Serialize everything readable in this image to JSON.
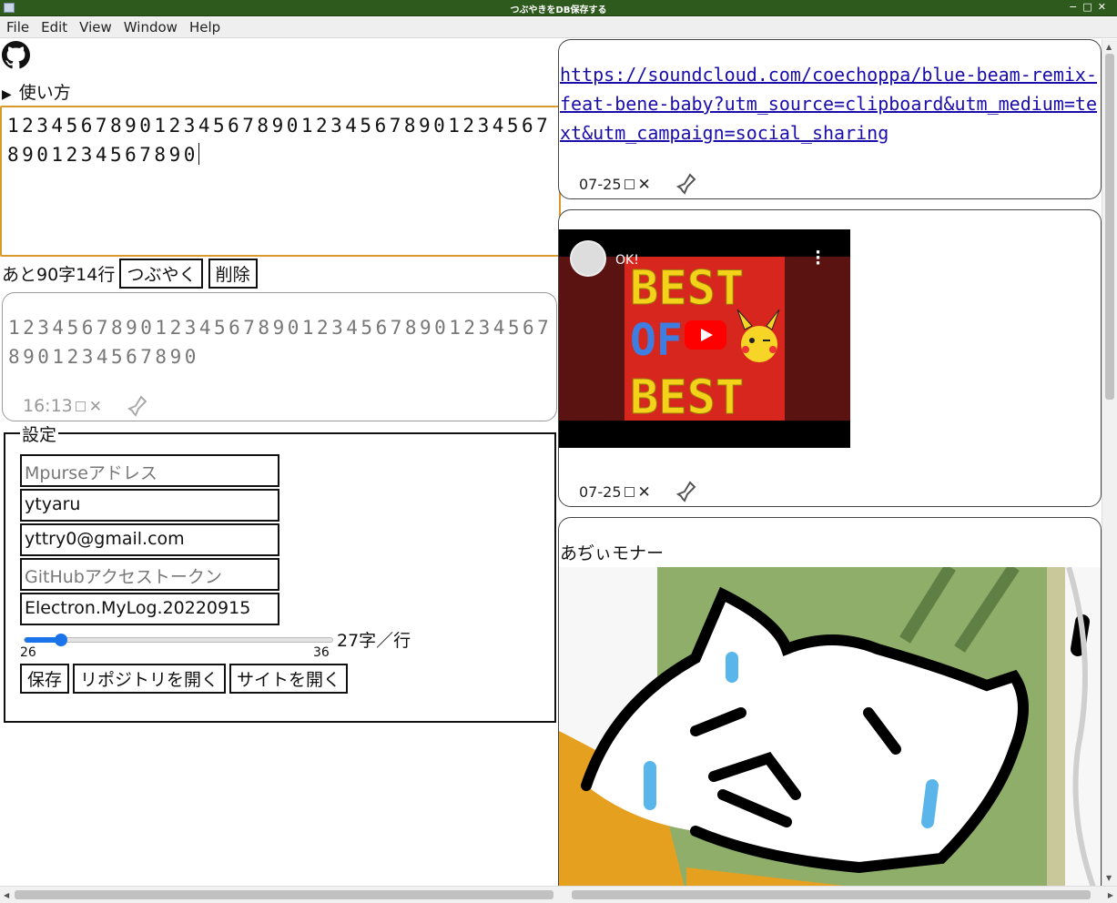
{
  "window": {
    "title": "つぶやきをDB保存する"
  },
  "menu": [
    "File",
    "Edit",
    "View",
    "Window",
    "Help"
  ],
  "left": {
    "usage_label": "使い方",
    "editor_text": "12345678901234567890123456789012345678901234567890",
    "counter": "あと90字14行",
    "tweet_button": "つぶやく",
    "delete_button": "削除",
    "draft": {
      "text": "12345678901234567890123456789012345678901234567890",
      "time": "16:13"
    }
  },
  "settings": {
    "legend": "設定",
    "mpurse_placeholder": "Mpurseアドレス",
    "username": "ytyaru",
    "email": "yttry0@gmail.com",
    "token_placeholder": "GitHubアクセストークン",
    "repo": "Electron.MyLog.20220915",
    "slider": {
      "min": "26",
      "max": "36",
      "value": 27,
      "label": "27字／行"
    },
    "save_button": "保存",
    "open_repo_button": "リポジトリを開く",
    "open_site_button": "サイトを開く"
  },
  "posts": [
    {
      "url": "https://soundcloud.com/coechoppa/blue-beam-remix-feat-bene-baby?utm_source=clipboard&utm_medium=text&utm_campaign=social_sharing",
      "date": "07-25"
    },
    {
      "video_title": "OK!",
      "thumbnail_text_top": "BEST",
      "thumbnail_text_mid": "OF",
      "thumbnail_text_bottom": "BEST",
      "date": "07-25"
    },
    {
      "name": "あぢぃモナー"
    }
  ],
  "colors": {
    "titlebar": "#2f5a1e",
    "editor_border": "#d99a2b",
    "link": "#1a0dab",
    "slider": "#1a73e8"
  }
}
